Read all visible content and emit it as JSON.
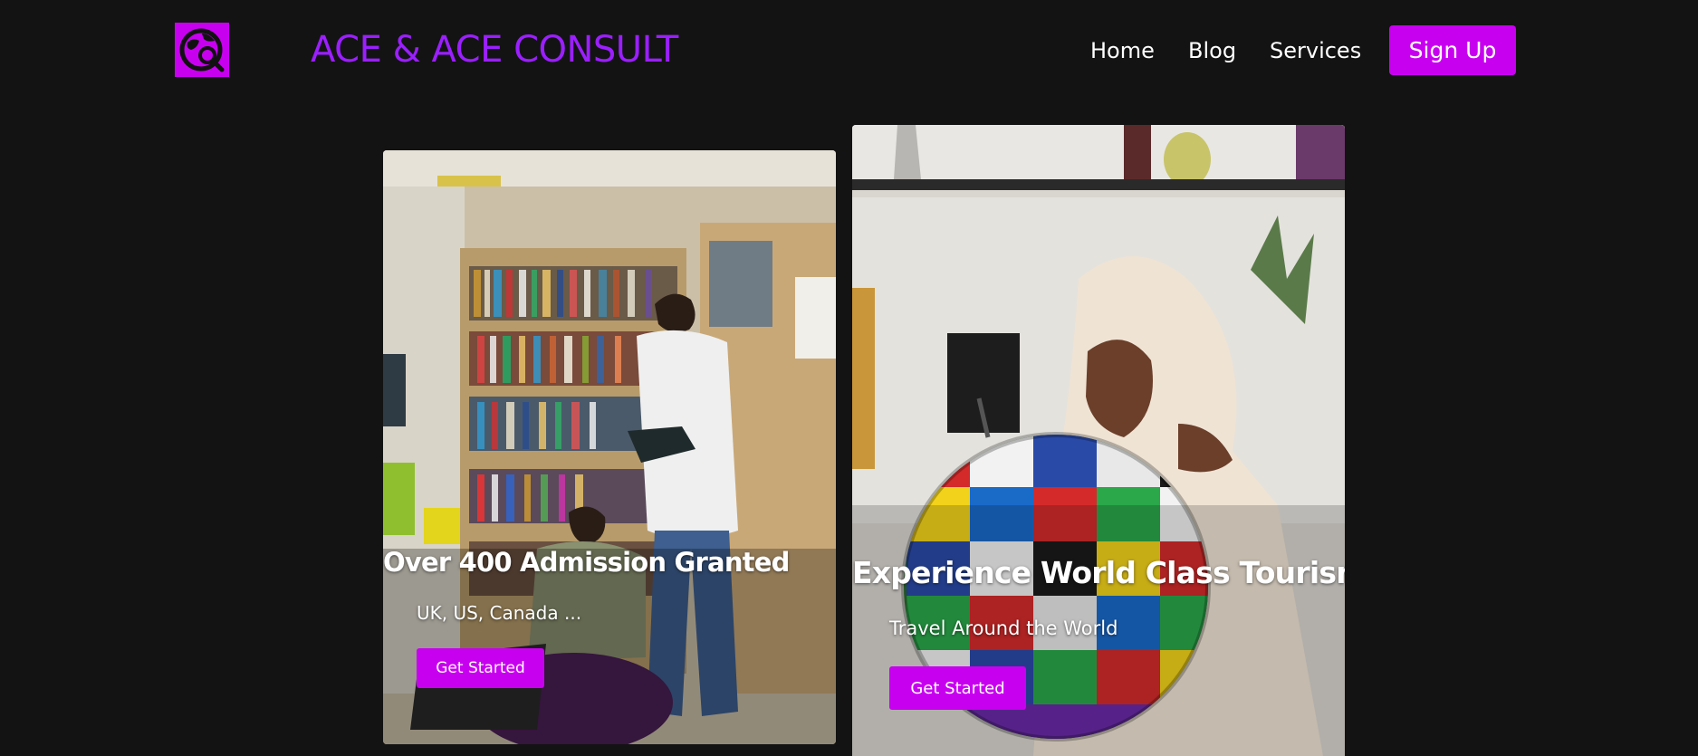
{
  "header": {
    "brand": "ACE & ACE CONSULT",
    "logo_icon": "globe-search-icon",
    "nav": [
      {
        "label": "Home"
      },
      {
        "label": "Blog"
      },
      {
        "label": "Services"
      }
    ],
    "signup_label": "Sign Up"
  },
  "cards": [
    {
      "title": "Over 400 Admission Granted",
      "subtitle": "UK, US, Canada ...",
      "button_label": "Get Started",
      "image": "students-reading-in-library"
    },
    {
      "title": "Experience World Class Tourism",
      "subtitle": "Travel Around the World",
      "button_label": "Get Started",
      "image": "woman-with-flag-globe"
    }
  ],
  "colors": {
    "background": "#131313",
    "brand_text": "#9b1fff",
    "accent": "#c800f0"
  }
}
